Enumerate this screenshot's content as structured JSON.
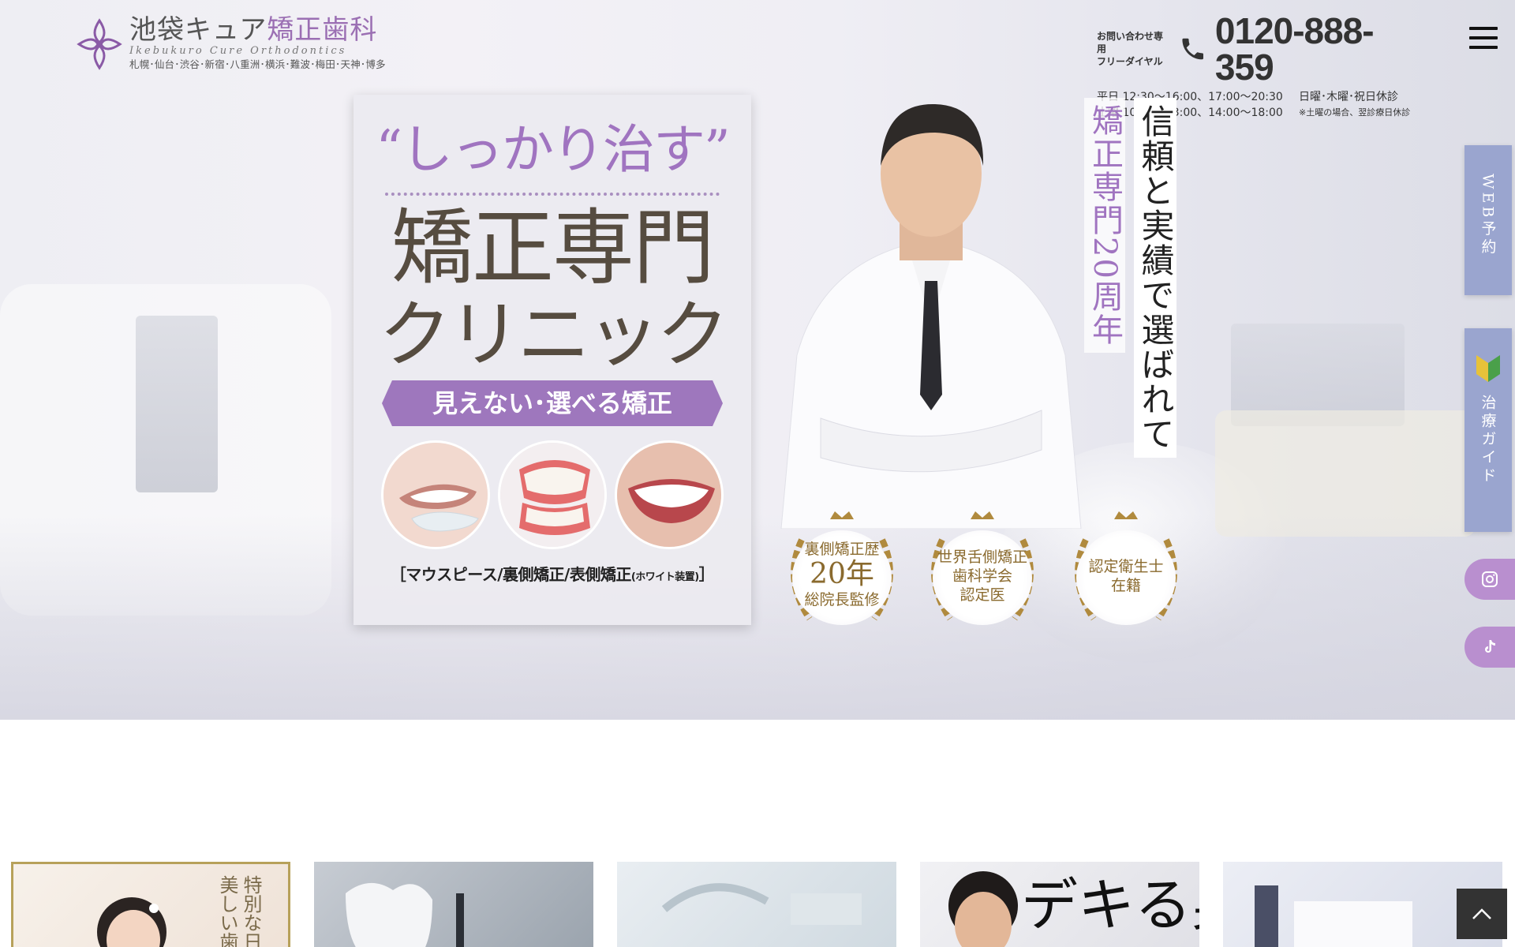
{
  "header": {
    "logo_title_main": "池袋キュア",
    "logo_title_accent": "矯正歯科",
    "logo_sub": "Ikebukuro Cure Orthodontics",
    "logo_branches": "札幌･仙台･渋谷･新宿･八重洲･横浜･難波･梅田･天神･博多",
    "contact_label_1": "お問い合わせ専用",
    "contact_label_2": "フリーダイヤル",
    "phone": "0120-888-359",
    "hours_weekday": "平日 12:30～16:00、17:00～20:30",
    "closed_days": "日曜･木曜･祝日休診",
    "hours_saturday": "土曜 10:00～13:00、14:00～18:00",
    "closed_note": "※土曜の場合、翌診療日休診"
  },
  "hero": {
    "catch": "“しっかり治す”",
    "heading_1": "矯正専門",
    "heading_2": "クリニック",
    "ribbon": "見えない･選べる矯正",
    "types_main": "［マウスピース/裏側矯正/表側矯正",
    "types_small": "(ホワイト装置)",
    "types_end": "］",
    "vertical_main": "信頼と実績で選ばれて",
    "vertical_sub": "矯正専門20周年",
    "badges": [
      {
        "line1": "裏側矯正歴",
        "big": "20年",
        "line3": "総院長監修"
      },
      {
        "line1": "世界舌側矯正",
        "line2": "歯科学会",
        "line3": "認定医"
      },
      {
        "line1": "認定衛生士",
        "line2": "在籍"
      }
    ]
  },
  "side": {
    "web_reservation": "WEB予約",
    "treatment_guide": "治療ガイド"
  },
  "tiles": {
    "tile1_text_a": "特別な日",
    "tile1_text_b": "美しい歯",
    "tile4_text": "デキる男の"
  },
  "colors": {
    "accent_purple": "#a074c0",
    "side_tab_blue": "#9aa5cf",
    "gold": "#b08a3e",
    "heading_brown": "#564c40"
  }
}
